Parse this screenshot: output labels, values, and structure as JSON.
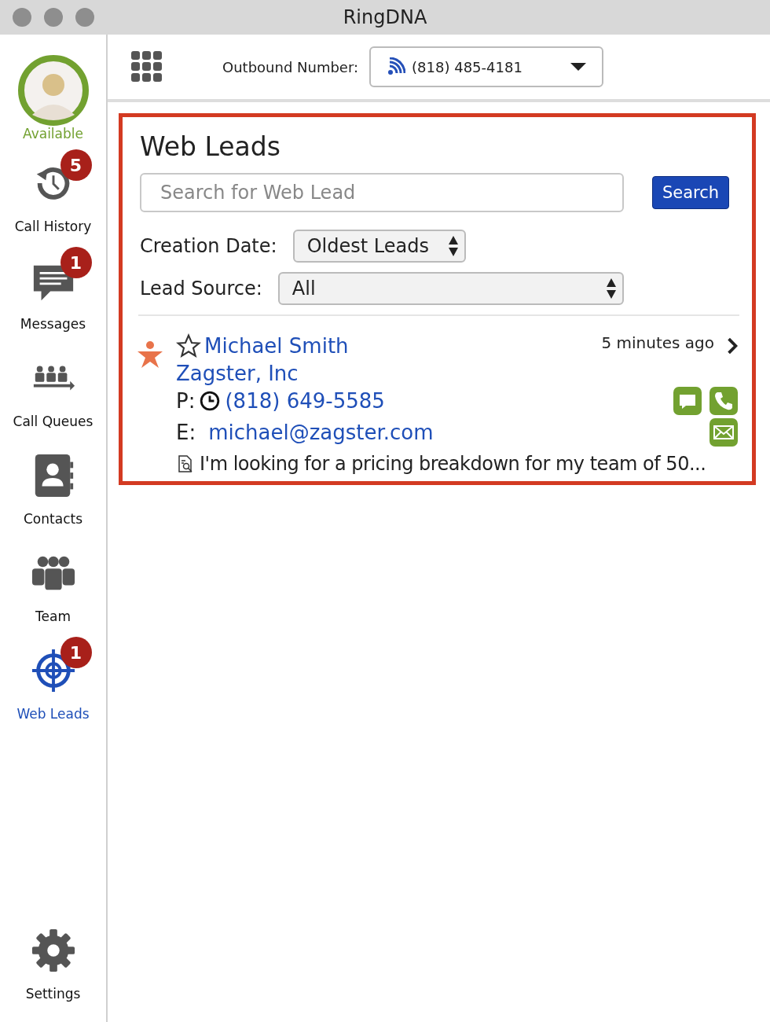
{
  "window": {
    "title": "RingDNA"
  },
  "status": {
    "label": "Available"
  },
  "sidebar": {
    "items": [
      {
        "label": "Call History",
        "badge": "5",
        "selected": false
      },
      {
        "label": "Messages",
        "badge": "1",
        "selected": false
      },
      {
        "label": "Call Queues",
        "selected": false
      },
      {
        "label": "Contacts",
        "selected": false
      },
      {
        "label": "Team",
        "selected": false
      },
      {
        "label": "Web Leads",
        "badge": "1",
        "selected": true
      }
    ],
    "settings": {
      "label": "Settings"
    }
  },
  "toolbar": {
    "outbound_label": "Outbound Number:",
    "outbound_number": "(818) 485-4181"
  },
  "web_leads": {
    "title": "Web Leads",
    "search": {
      "placeholder": "Search for Web Lead",
      "button": "Search"
    },
    "filters": [
      {
        "label": "Creation Date:",
        "value": "Oldest Leads"
      },
      {
        "label": "Lead Source:",
        "value": "All"
      }
    ],
    "leads": [
      {
        "name": "Michael Smith",
        "starred": false,
        "company": "Zagster, Inc",
        "time": "5 minutes ago",
        "phone_label": "P:",
        "phone": "(818) 649-5585",
        "email_label": "E:",
        "email": "michael@zagster.com",
        "note": "I'm looking for a pricing breakdown for my team of 50..."
      }
    ]
  }
}
